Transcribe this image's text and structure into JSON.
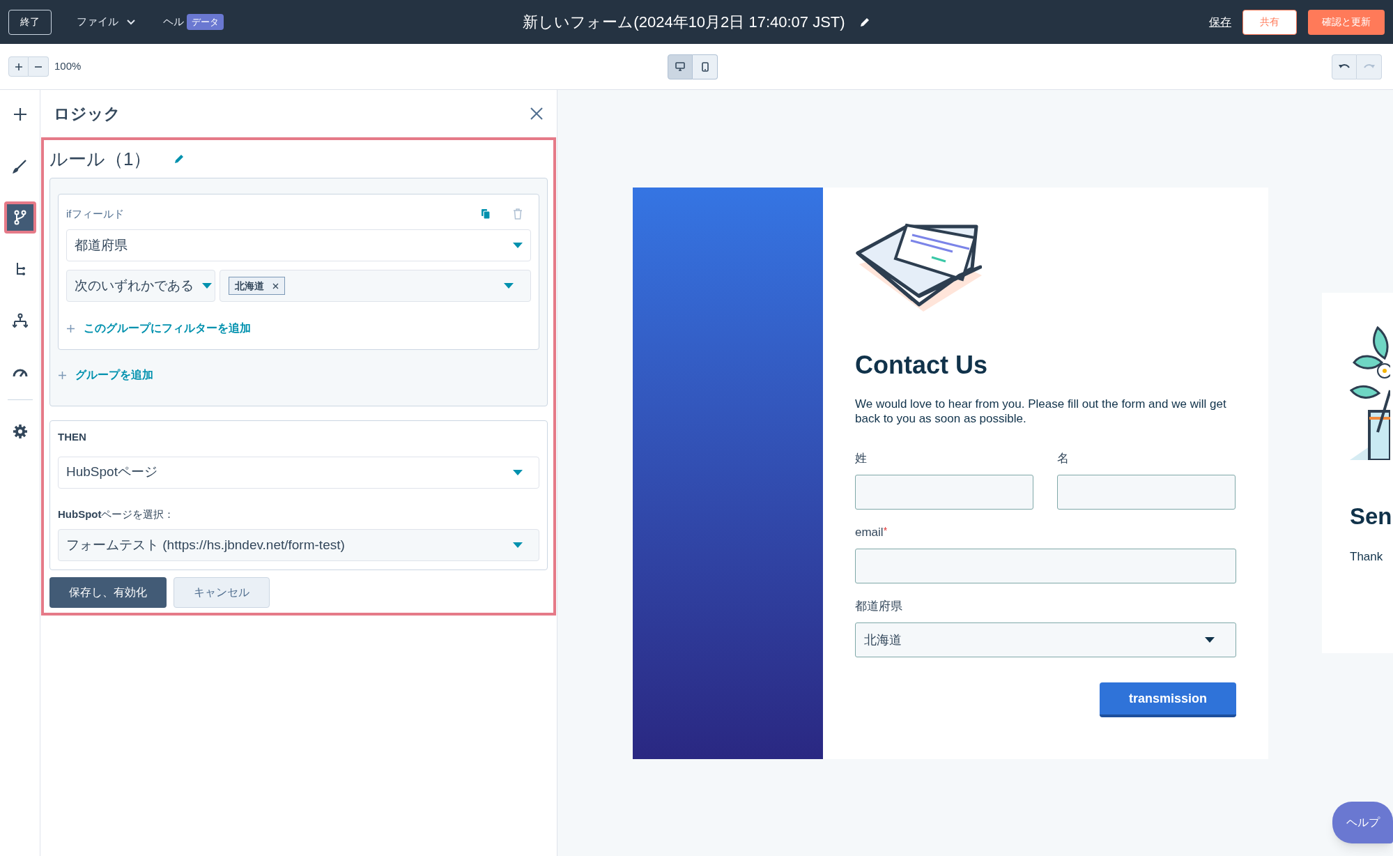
{
  "top_bar": {
    "exit_button": "終了",
    "menus": [
      {
        "label": "ファイル",
        "kind": "dropdown"
      },
      {
        "label": "ヘル",
        "kind": "plain"
      }
    ],
    "badge": "データ",
    "title": "新しいフォーム(2024年10月2日 17:40:07 JST)",
    "save_link": "保存",
    "share_button": "共有",
    "review_button": "確認と更新"
  },
  "toolbar": {
    "zoom": "100%",
    "devices": [
      {
        "kind": "desktop",
        "selected": true
      },
      {
        "kind": "mobile",
        "selected": false
      }
    ]
  },
  "sidebar": {
    "items": [
      {
        "kind": "plus",
        "selected": false
      },
      {
        "kind": "brush",
        "selected": false
      },
      {
        "kind": "branch",
        "selected": true
      },
      {
        "kind": "tree",
        "selected": false
      },
      {
        "kind": "hierarchy",
        "selected": false
      },
      {
        "kind": "gauge",
        "selected": false
      },
      {
        "kind": "gear",
        "selected": false
      }
    ]
  },
  "logic_panel": {
    "title": "ロジック",
    "rule_title": "ルール（1）",
    "if_label": "ifフィールド",
    "field": "都道府県",
    "operator": "次のいずれかである",
    "tags": [
      "北海道"
    ],
    "add_filter": "このグループにフィルターを追加",
    "add_group": "グループを追加",
    "then_label": "THEN",
    "action": "HubSpotページ",
    "page_label": "**HubSpot**ページを選択：",
    "page_value": "フォームテスト (https://hs.jbndev.net/form-test)",
    "save_button": "保存し、有効化",
    "cancel_button": "キャンセル"
  },
  "form": {
    "title": "Contact Us",
    "description": "We would love to hear from you. Please fill out the form and we will get back to you as soon as possible.",
    "fields": [
      {
        "label": "姓",
        "kind": "half"
      },
      {
        "label": "名",
        "kind": "half"
      },
      {
        "label": "email",
        "kind": "full",
        "required_mark": "*"
      },
      {
        "label": "都道府県",
        "kind": "select",
        "value": "北海道"
      }
    ],
    "submit": "transmission"
  },
  "thank_you": {
    "title": "Sen",
    "text": "Thank"
  },
  "help_button": "ヘルプ"
}
